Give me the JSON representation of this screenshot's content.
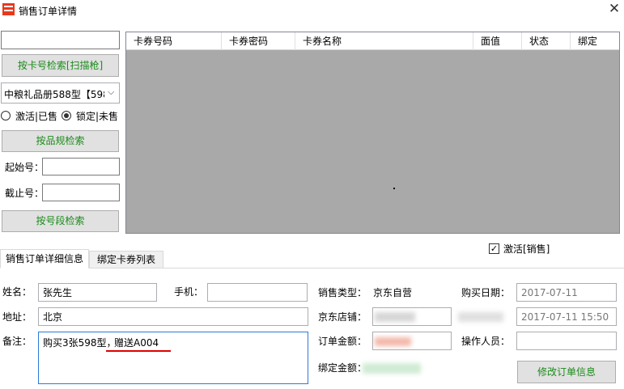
{
  "window": {
    "title": "销售订单详情",
    "close": "✕"
  },
  "left": {
    "search_btn": "按卡号检索[扫描枪]",
    "product_select": "中粮礼品册588型【598",
    "radio_active": "激活|已售",
    "radio_locked": "锁定|未售",
    "spec_btn": "按品规检索",
    "start_label": "起始号：",
    "end_label": "截止号：",
    "range_btn": "按号段检索"
  },
  "grid": {
    "columns": [
      "卡券号码",
      "卡券密码",
      "卡券名称",
      "面值",
      "状态",
      "绑定"
    ]
  },
  "activate_checkbox": "激活[销售]",
  "tabs": [
    "销售订单详细信息",
    "绑定卡券列表"
  ],
  "form": {
    "name_label": "姓名：",
    "name": "张先生",
    "phone_label": "手机：",
    "address_label": "地址：",
    "address": "北京",
    "remark_label": "备注：",
    "remark_normal": "购买3张598型，",
    "remark_highlight": "赠送A004",
    "sale_type_label": "销售类型：",
    "sale_type": "京东自营",
    "store_label": "京东店铺：",
    "amount_label": "订单金额：",
    "bind_amount_label": "绑定金额：",
    "buy_date_label": "购买日期：",
    "buy_date": "2017-07-11",
    "datetime": "2017-07-11 15:50",
    "operator_label": "操作人员：",
    "modify_btn": "修改订单信息"
  },
  "colors": {
    "accent_green": "#1a8b1a",
    "underline_red": "#e00000",
    "grid_bg": "#a9a9a9"
  }
}
